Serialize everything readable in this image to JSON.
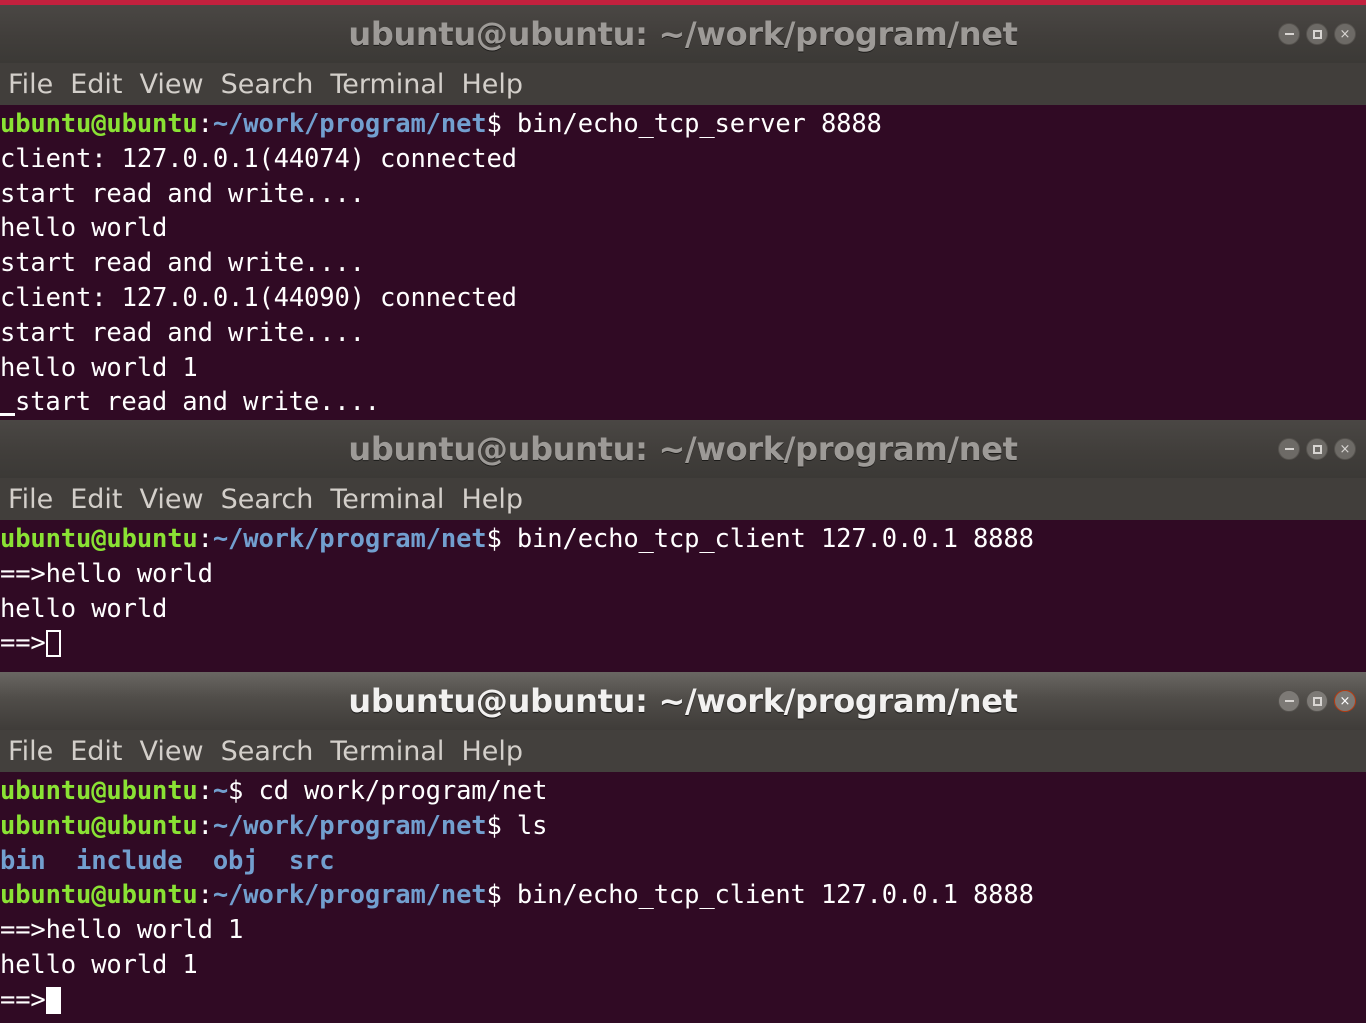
{
  "desktop": {
    "top_strip_color": "#c3213e",
    "terminal_bg": "#300a24",
    "prompt_user_color": "#8ae234",
    "prompt_path_color": "#729fcf",
    "accent_close_color": "#dd4814"
  },
  "menu": {
    "file": "File",
    "edit": "Edit",
    "view": "View",
    "search": "Search",
    "terminal": "Terminal",
    "help": "Help"
  },
  "controls": {
    "minimize_icon": "minimize-icon",
    "maximize_icon": "maximize-icon",
    "close_icon": "close-icon",
    "close_glyph": "×"
  },
  "windows": [
    {
      "id": "win1",
      "title": "ubuntu@ubuntu: ~/work/program/net",
      "focused": false,
      "lines": [
        {
          "segments": [
            {
              "text": "ubuntu@ubuntu",
              "style": "user"
            },
            {
              "text": ":",
              "style": "plain"
            },
            {
              "text": "~/work/program/net",
              "style": "path"
            },
            {
              "text": "$ bin/echo_tcp_server 8888",
              "style": "plain"
            }
          ]
        },
        {
          "segments": [
            {
              "text": "client: 127.0.0.1(44074) connected",
              "style": "plain"
            }
          ]
        },
        {
          "segments": [
            {
              "text": "start read and write....",
              "style": "plain"
            }
          ]
        },
        {
          "segments": [
            {
              "text": "hello world",
              "style": "plain"
            }
          ]
        },
        {
          "segments": [
            {
              "text": "start read and write....",
              "style": "plain"
            }
          ]
        },
        {
          "segments": [
            {
              "text": "client: 127.0.0.1(44090) connected",
              "style": "plain"
            }
          ]
        },
        {
          "segments": [
            {
              "text": "start read and write....",
              "style": "plain"
            }
          ]
        },
        {
          "segments": [
            {
              "text": "hello world 1",
              "style": "plain"
            }
          ]
        },
        {
          "segments": [
            {
              "text": "start read and write....",
              "style": "plain"
            }
          ],
          "cursor": "underline",
          "cursor_position": "start"
        }
      ]
    },
    {
      "id": "win2",
      "title": "ubuntu@ubuntu: ~/work/program/net",
      "focused": false,
      "lines": [
        {
          "segments": [
            {
              "text": "ubuntu@ubuntu",
              "style": "user"
            },
            {
              "text": ":",
              "style": "plain"
            },
            {
              "text": "~/work/program/net",
              "style": "path"
            },
            {
              "text": "$ bin/echo_tcp_client 127.0.0.1 8888",
              "style": "plain"
            }
          ]
        },
        {
          "segments": [
            {
              "text": "==>hello world",
              "style": "plain"
            }
          ]
        },
        {
          "segments": [
            {
              "text": "hello world",
              "style": "plain"
            }
          ]
        },
        {
          "segments": [
            {
              "text": "==>",
              "style": "plain"
            }
          ],
          "cursor": "hollow"
        }
      ]
    },
    {
      "id": "win3",
      "title": "ubuntu@ubuntu: ~/work/program/net",
      "focused": true,
      "lines": [
        {
          "segments": [
            {
              "text": "ubuntu@ubuntu",
              "style": "user"
            },
            {
              "text": ":",
              "style": "plain"
            },
            {
              "text": "~",
              "style": "path"
            },
            {
              "text": "$ cd work/program/net",
              "style": "plain"
            }
          ]
        },
        {
          "segments": [
            {
              "text": "ubuntu@ubuntu",
              "style": "user"
            },
            {
              "text": ":",
              "style": "plain"
            },
            {
              "text": "~/work/program/net",
              "style": "path"
            },
            {
              "text": "$ ls",
              "style": "plain"
            }
          ]
        },
        {
          "segments": [
            {
              "text": "bin  include  obj  src",
              "style": "dir"
            }
          ]
        },
        {
          "segments": [
            {
              "text": "ubuntu@ubuntu",
              "style": "user"
            },
            {
              "text": ":",
              "style": "plain"
            },
            {
              "text": "~/work/program/net",
              "style": "path"
            },
            {
              "text": "$ bin/echo_tcp_client 127.0.0.1 8888",
              "style": "plain"
            }
          ]
        },
        {
          "segments": [
            {
              "text": "==>hello world 1",
              "style": "plain"
            }
          ]
        },
        {
          "segments": [
            {
              "text": "hello world 1",
              "style": "plain"
            }
          ]
        },
        {
          "segments": [
            {
              "text": "==>",
              "style": "plain"
            }
          ],
          "cursor": "block"
        }
      ]
    }
  ]
}
